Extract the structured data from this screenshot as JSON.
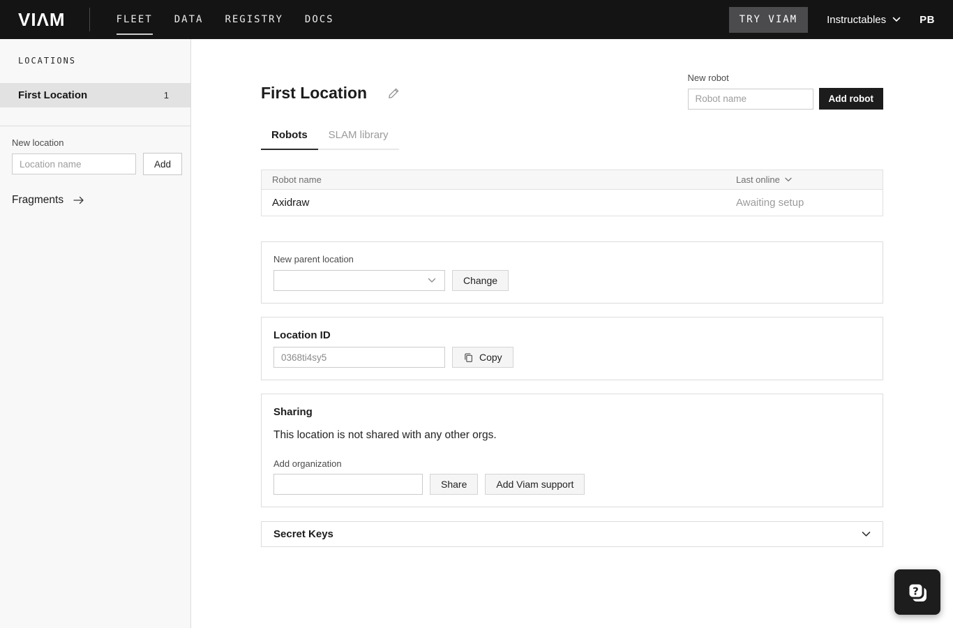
{
  "nav": {
    "logo": "VIΛM",
    "links": [
      {
        "label": "FLEET",
        "active": true
      },
      {
        "label": "DATA",
        "active": false
      },
      {
        "label": "REGISTRY",
        "active": false
      },
      {
        "label": "DOCS",
        "active": false
      }
    ],
    "try_viam_label": "TRY VIAM",
    "org_name": "Instructables",
    "avatar_initials": "PB"
  },
  "sidebar": {
    "heading": "LOCATIONS",
    "locations": [
      {
        "name": "First Location",
        "count": "1",
        "selected": true
      }
    ],
    "new_location": {
      "label": "New location",
      "placeholder": "Location name",
      "add_label": "Add"
    },
    "fragments_label": "Fragments"
  },
  "main": {
    "title": "First Location",
    "new_robot": {
      "label": "New robot",
      "placeholder": "Robot name",
      "button_label": "Add robot"
    },
    "tabs": [
      {
        "label": "Robots",
        "active": true
      },
      {
        "label": "SLAM library",
        "active": false
      }
    ],
    "robots_table": {
      "columns": [
        "Robot name",
        "Last online"
      ],
      "rows": [
        {
          "name": "Axidraw",
          "last_online": "Awaiting setup"
        }
      ]
    },
    "parent_location": {
      "label": "New parent location",
      "selected_value": "",
      "button_label": "Change"
    },
    "location_id": {
      "heading": "Location ID",
      "value": "0368ti4sy5",
      "copy_label": "Copy"
    },
    "sharing": {
      "heading": "Sharing",
      "message": "This location is not shared with any other orgs.",
      "add_org_label": "Add organization",
      "add_org_value": "",
      "share_label": "Share",
      "support_label": "Add Viam support"
    },
    "secret_keys": {
      "heading": "Secret Keys"
    }
  },
  "icons": {
    "org_switcher": "chevron-down",
    "fragments": "arrow-right",
    "title_edit": "pencil",
    "last_online_sort": "chevron-down",
    "parent_location_select": "chevron-down",
    "location_id_copy": "copy",
    "secret_keys_collapse": "chevron-down",
    "help_widget": "question-mark-bubble"
  },
  "colors": {
    "nav_background": "#141414",
    "primary_button": "#1c1c1c",
    "selected_row": "#e2e2e2",
    "muted_text": "#9b9b9b",
    "card_border": "#dcdcdc"
  }
}
